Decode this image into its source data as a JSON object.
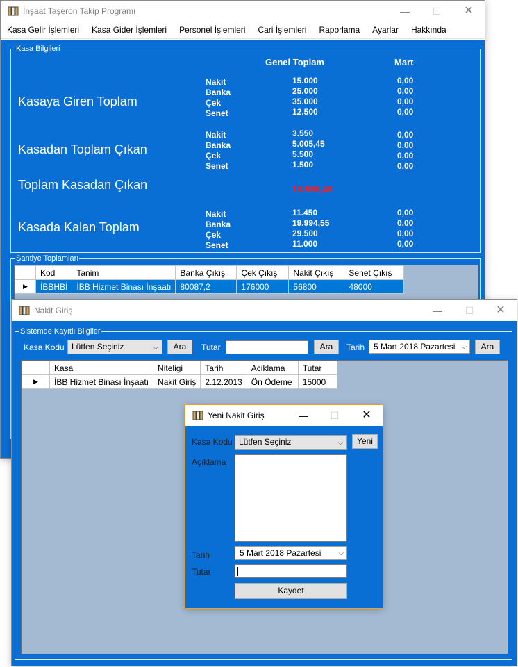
{
  "main": {
    "title": "İnşaat Taşeron Takip Programı",
    "menu": [
      "Kasa Gelir İşlemleri",
      "Kasa Gider İşlemleri",
      "Personel İşlemleri",
      "Cari İşlemleri",
      "Raporlama",
      "Ayarlar",
      "Hakkında"
    ],
    "kasa": {
      "legend": "Kasa Bilgileri",
      "col_total": "Genel Toplam",
      "col_month": "Mart",
      "giren_title": "Kasaya Giren Toplam",
      "cikan_title": "Kasadan Toplam Çıkan",
      "toplam_cikan_title": "Toplam Kasadan Çıkan",
      "toplam_cikan_value": "15.555,45",
      "kalan_title": "Kasada Kalan Toplam",
      "labels": [
        "Nakit",
        "Banka",
        "Çek",
        "Senet"
      ],
      "giren": {
        "total": [
          "15.000",
          "25.000",
          "35.000",
          "12.500"
        ],
        "month": [
          "0,00",
          "0,00",
          "0,00",
          "0,00"
        ]
      },
      "cikan": {
        "total": [
          "3.550",
          "5.005,45",
          "5.500",
          "1.500"
        ],
        "month": [
          "0,00",
          "0,00",
          "0,00",
          "0,00"
        ]
      },
      "kalan": {
        "total": [
          "11.450",
          "19.994,55",
          "29.500",
          "11.000"
        ],
        "month": [
          "0,00",
          "0,00",
          "0,00",
          "0,00"
        ]
      }
    },
    "santiye": {
      "legend": "Şantiye Toplamları",
      "headers": [
        "Kod",
        "Tanim",
        "Banka Çıkış",
        "Çek Çıkış",
        "Nakit Çıkış",
        "Senet Çıkış"
      ],
      "row": [
        "İBBHBİ",
        "İBB Hizmet Binası İnşaatı",
        "80087,2",
        "176000",
        "56800",
        "48000"
      ]
    }
  },
  "nakit": {
    "title": "Nakit Giriş",
    "legend": "Sistemde Kayıtlı Bilgiler",
    "kasa_kodu_label": "Kasa Kodu",
    "kasa_select": "Lütfen Seçiniz",
    "ara": "Ara",
    "tutar_label": "Tutar",
    "tarih_label": "Tarih",
    "tarih_value": "5   Mart   2018 Pazartesi",
    "headers": [
      "Kasa",
      "Niteligi",
      "Tarih",
      "Aciklama",
      "Tutar"
    ],
    "row": [
      "İBB Hizmet Binası İnşaatı",
      "Nakit Giriş",
      "2.12.2013",
      "Ön Ödeme",
      "15000"
    ]
  },
  "yeni": {
    "title": "Yeni Nakit Giriş",
    "kasa_kodu_label": "Kasa Kodu",
    "kasa_select": "Lütfen Seçiniz",
    "yeni_button": "Yeni",
    "aciklama_label": "Açıklama",
    "tarih_label": "Tarih",
    "tarih_value": "5   Mart   2018  Pazartesi",
    "tutar_label": "Tutar",
    "kaydet": "Kaydet"
  },
  "icons": {
    "app": "book-icon",
    "minimize": "minimize-icon",
    "maximize": "maximize-icon",
    "close": "close-icon",
    "dropdown": "chevron-down-icon",
    "row_pointer": "row-pointer-icon"
  },
  "colors": {
    "panel": "#0a6fd4",
    "grid_bg": "#a4bad3",
    "selection": "#0078d7",
    "highlight_value": "#ff1a1a"
  }
}
